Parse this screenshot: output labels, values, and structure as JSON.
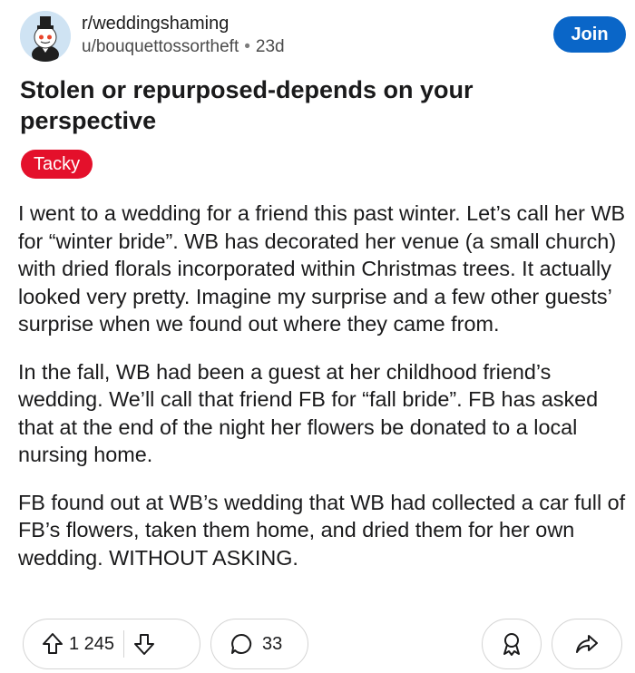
{
  "header": {
    "subreddit": "r/weddingshaming",
    "user": "u/bouquettossortheft",
    "separator": "•",
    "age": "23d",
    "join_label": "Join"
  },
  "post": {
    "title": "Stolen or repurposed-depends on your perspective",
    "flair": "Tacky",
    "paragraphs": [
      "I went to a wedding for a friend this past winter. Let’s call her WB for “winter bride”. WB has decorated her venue (a small church) with dried florals incorporated within Christmas trees. It actually looked very pretty. Imagine my surprise and a few other guests’ surprise when we found out where they came from.",
      "In the fall, WB had been a guest at her childhood friend’s wedding. We’ll call that friend FB for “fall bride”. FB has asked that at the end of the night her flowers be donated to a local nursing home.",
      "FB found out at WB’s wedding that WB had collected a car full of FB’s flowers, taken them home, and dried them for her own wedding. WITHOUT ASKING."
    ]
  },
  "actions": {
    "upvote_count": "1 245",
    "comment_count": "33",
    "icons": [
      "upvote-icon",
      "downvote-icon",
      "comment-icon",
      "award-icon",
      "share-icon"
    ]
  },
  "colors": {
    "join_bg": "#0a66c8",
    "flair_bg": "#e4102b",
    "border": "#d4d4d4"
  }
}
